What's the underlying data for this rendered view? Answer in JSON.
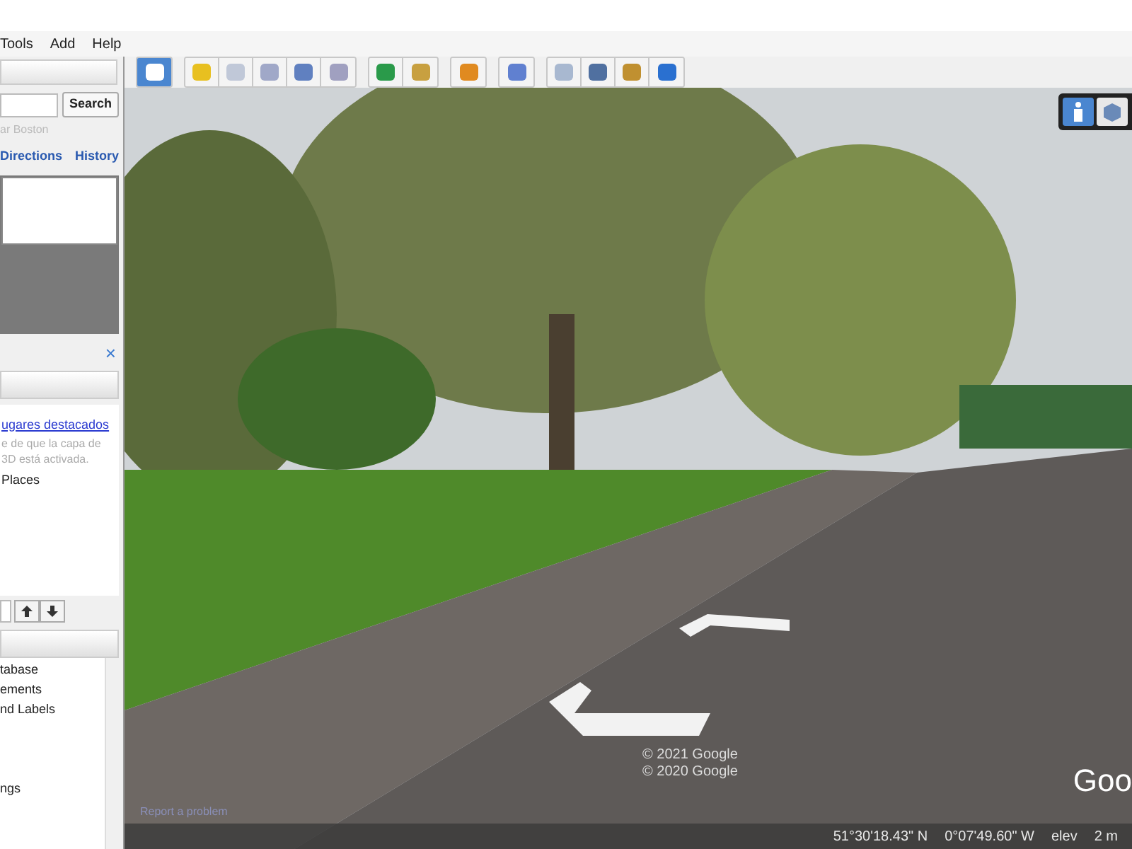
{
  "menu": [
    "Tools",
    "Add",
    "Help"
  ],
  "toolbar": [
    {
      "selected": true
    },
    {
      "selected": false
    },
    {
      "selected": false
    },
    {
      "selected": false
    },
    {
      "selected": false
    },
    {
      "selected": false
    },
    {
      "selected": false
    },
    {
      "selected": false
    },
    {
      "selected": false
    },
    {
      "selected": false
    },
    {
      "selected": false
    },
    {
      "selected": false
    },
    {
      "selected": false
    },
    {
      "selected": false
    }
  ],
  "search": {
    "button": "Search",
    "hint": "ar Boston",
    "tabs": [
      {
        "label": "Directions",
        "selected": false
      },
      {
        "label": "History",
        "selected": false
      }
    ]
  },
  "places": {
    "close": "×",
    "link": "ugares destacados",
    "text": "e de que la capa de 3D está activada.",
    "item": "Places"
  },
  "layers": {
    "items": [
      "tabase",
      "ements",
      "nd Labels",
      "ngs"
    ]
  },
  "view_modes": [
    {
      "selected": true
    },
    {
      "selected": false
    }
  ],
  "map": {
    "copyright": [
      "© 2021 Google",
      "© 2020 Google"
    ],
    "logo": "Goo",
    "report": "Report a problem"
  },
  "status_bar": {
    "lat": "51°30'18.43\" N",
    "lon": "0°07'49.60\" W",
    "elev_label": "elev",
    "elev": "2 m"
  }
}
